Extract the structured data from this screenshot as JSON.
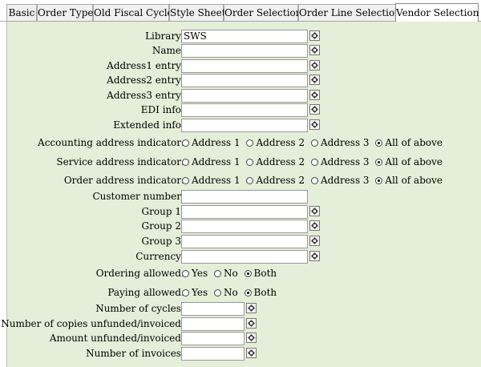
{
  "tabs": [
    "Basic",
    "Order Type",
    "Old Fiscal Cycle",
    "Style Sheet",
    "Order Selection",
    "Order Line Selection",
    "Vendor Selection"
  ],
  "active_tab": "Vendor Selection",
  "fields": {
    "library": {
      "label": "Library:",
      "value": "SWS"
    },
    "name": {
      "label": "Name:",
      "value": ""
    },
    "address1": {
      "label": "Address1 entry:",
      "value": ""
    },
    "address2": {
      "label": "Address2 entry:",
      "value": ""
    },
    "address3": {
      "label": "Address3 entry:",
      "value": ""
    },
    "edi": {
      "label": "EDI info:",
      "value": ""
    },
    "extended": {
      "label": "Extended info:",
      "value": ""
    },
    "customer_number": {
      "label": "Customer number:",
      "value": ""
    },
    "group1": {
      "label": "Group 1:",
      "value": ""
    },
    "group2": {
      "label": "Group 2:",
      "value": ""
    },
    "group3": {
      "label": "Group 3:",
      "value": ""
    },
    "currency": {
      "label": "Currency:",
      "value": ""
    },
    "num_cycles": {
      "label": "Number of cycles:",
      "value": ""
    },
    "num_copies": {
      "label": "Number of copies unfunded/invoiced:",
      "value": ""
    },
    "amount": {
      "label": "Amount unfunded/invoiced:",
      "value": ""
    },
    "num_invoices": {
      "label": "Number of invoices:",
      "value": ""
    }
  },
  "radio_groups": {
    "accounting": {
      "label": "Accounting address indicator:",
      "options": [
        "Address 1",
        "Address 2",
        "Address 3",
        "All of above"
      ],
      "selected": "All of above"
    },
    "service": {
      "label": "Service address indicator:",
      "options": [
        "Address 1",
        "Address 2",
        "Address 3",
        "All of above"
      ],
      "selected": "All of above"
    },
    "order": {
      "label": "Order address indicator:",
      "options": [
        "Address 1",
        "Address 2",
        "Address 3",
        "All of above"
      ],
      "selected": "All of above"
    },
    "ordering": {
      "label": "Ordering allowed:",
      "options": [
        "Yes",
        "No",
        "Both"
      ],
      "selected": "Both"
    },
    "paying": {
      "label": "Paying allowed:",
      "options": [
        "Yes",
        "No",
        "Both"
      ],
      "selected": "Both"
    }
  },
  "icons": {
    "lookup": "diamond-lookup-icon"
  }
}
